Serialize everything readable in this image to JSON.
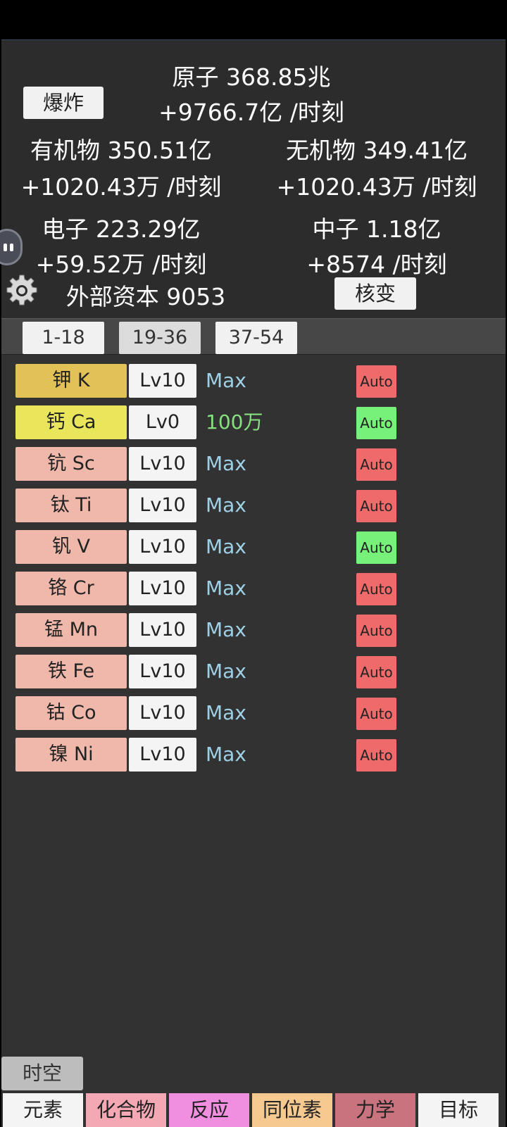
{
  "header": {
    "atoms": "原子 368.85兆",
    "atoms_rate": "+9766.7亿 /时刻",
    "explode_label": "爆炸",
    "organic": "有机物 350.51亿",
    "organic_rate": "+1020.43万 /时刻",
    "inorganic": "无机物 349.41亿",
    "inorganic_rate": "+1020.43万 /时刻",
    "electrons": "电子 223.29亿",
    "electrons_rate": "+59.52万 /时刻",
    "neutrons": "中子 1.18亿",
    "neutrons_rate": "+8574 /时刻",
    "external_capital": "外部资本 9053",
    "fission_label": "核变"
  },
  "range_tabs": [
    "1-18",
    "19-36",
    "37-54"
  ],
  "elements": [
    {
      "name": "钾 K",
      "level": "Lv10",
      "cost": "Max",
      "auto": "Auto",
      "name_color": "#e2c157",
      "cost_color": "#9ed0e6",
      "auto_color": "#ef6b6b"
    },
    {
      "name": "钙 Ca",
      "level": "Lv0",
      "cost": "100万",
      "auto": "Auto",
      "name_color": "#e9e65c",
      "cost_color": "#86e07f",
      "auto_color": "#77f17a"
    },
    {
      "name": "钪 Sc",
      "level": "Lv10",
      "cost": "Max",
      "auto": "Auto",
      "name_color": "#efb8ab",
      "cost_color": "#9ed0e6",
      "auto_color": "#ef6b6b"
    },
    {
      "name": "钛 Ti",
      "level": "Lv10",
      "cost": "Max",
      "auto": "Auto",
      "name_color": "#efb8ab",
      "cost_color": "#9ed0e6",
      "auto_color": "#ef6b6b"
    },
    {
      "name": "钒 V",
      "level": "Lv10",
      "cost": "Max",
      "auto": "Auto",
      "name_color": "#efb8ab",
      "cost_color": "#9ed0e6",
      "auto_color": "#77f17a"
    },
    {
      "name": "铬 Cr",
      "level": "Lv10",
      "cost": "Max",
      "auto": "Auto",
      "name_color": "#efb8ab",
      "cost_color": "#9ed0e6",
      "auto_color": "#ef6b6b"
    },
    {
      "name": "锰 Mn",
      "level": "Lv10",
      "cost": "Max",
      "auto": "Auto",
      "name_color": "#efb8ab",
      "cost_color": "#9ed0e6",
      "auto_color": "#ef6b6b"
    },
    {
      "name": "铁 Fe",
      "level": "Lv10",
      "cost": "Max",
      "auto": "Auto",
      "name_color": "#efb8ab",
      "cost_color": "#9ed0e6",
      "auto_color": "#ef6b6b"
    },
    {
      "name": "钴 Co",
      "level": "Lv10",
      "cost": "Max",
      "auto": "Auto",
      "name_color": "#efb8ab",
      "cost_color": "#9ed0e6",
      "auto_color": "#ef6b6b"
    },
    {
      "name": "镍 Ni",
      "level": "Lv10",
      "cost": "Max",
      "auto": "Auto",
      "name_color": "#efb8ab",
      "cost_color": "#9ed0e6",
      "auto_color": "#ef6b6b"
    }
  ],
  "spacetime_label": "时空",
  "bottom_nav": [
    {
      "label": "元素",
      "color": "#f4f4f4"
    },
    {
      "label": "化合物",
      "color": "#f3a8b4"
    },
    {
      "label": "反应",
      "color": "#f08ee0"
    },
    {
      "label": "同位素",
      "color": "#f6c990"
    },
    {
      "label": "力学",
      "color": "#c9737f"
    },
    {
      "label": "目标",
      "color": "#f4f4f4"
    }
  ]
}
